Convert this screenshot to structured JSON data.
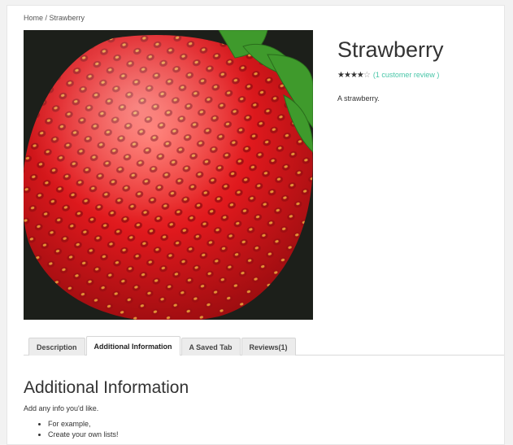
{
  "breadcrumb": {
    "home": "Home",
    "separator": " / ",
    "current": "Strawberry"
  },
  "product": {
    "title": "Strawberry",
    "rating": {
      "value": 4,
      "max": 5,
      "review_link": "(1 customer review )"
    },
    "short_description": "A strawberry.",
    "image_subject": "strawberry"
  },
  "tabs": [
    {
      "label": "Description",
      "active": false
    },
    {
      "label": "Additional Information",
      "active": true
    },
    {
      "label": "A Saved Tab",
      "active": false
    },
    {
      "label": "Reviews(1)",
      "active": false
    }
  ],
  "panel": {
    "title": "Additional Information",
    "text": "Add any info you'd like.",
    "list": [
      "For example,",
      "Create your own lists!"
    ]
  },
  "colors": {
    "link": "#49c6a8",
    "berry": "#d4141a",
    "leaf": "#3f9a2c"
  }
}
